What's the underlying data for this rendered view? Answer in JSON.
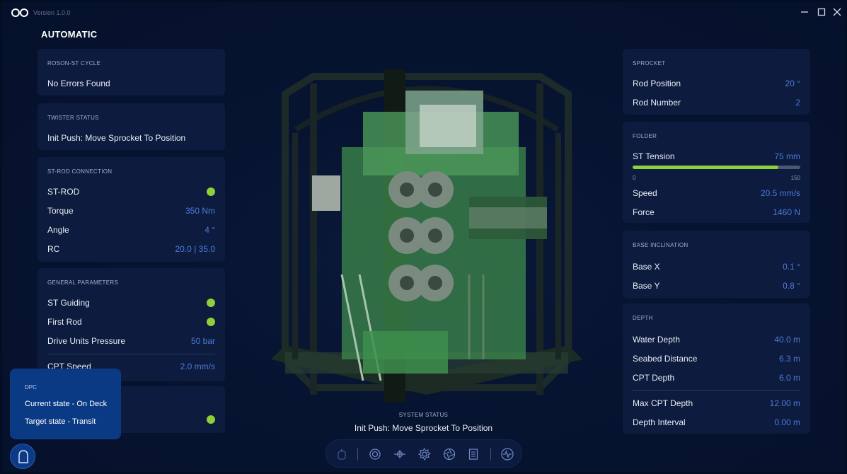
{
  "app": {
    "version": "Version 1.0.0",
    "page_title": "AUTOMATIC"
  },
  "left": {
    "cycle": {
      "title": "ROSON-ST CYCLE",
      "text": "No Errors Found"
    },
    "twister": {
      "title": "TWISTER STATUS",
      "text": "Init Push: Move Sprocket To Position"
    },
    "st_rod": {
      "title": "ST-ROD CONNECTION",
      "rows": [
        {
          "label": "ST-ROD",
          "status": "ok"
        },
        {
          "label": "Torque",
          "value": "350 Nm"
        },
        {
          "label": "Angle",
          "value": "4 °"
        },
        {
          "label": "RC",
          "value": "20.0 | 35.0"
        }
      ]
    },
    "general": {
      "title": "GENERAL PARAMETERS",
      "rows": [
        {
          "label": "ST Guiding",
          "status": "ok"
        },
        {
          "label": "First Rod",
          "status": "ok"
        },
        {
          "label": "Drive Units Pressure",
          "value": "50 bar"
        },
        {
          "label": "CPT Speed",
          "value": "2.0 mm/s"
        }
      ]
    }
  },
  "right": {
    "sprocket": {
      "title": "SPROCKET",
      "rows": [
        {
          "label": "Rod Position",
          "value": "20 °"
        },
        {
          "label": "Rod Number",
          "value": "2"
        }
      ]
    },
    "folder": {
      "title": "FOLDER",
      "tension_label": "ST Tension",
      "tension_value": "75 mm",
      "tension_min": "0",
      "tension_max": "150",
      "tension_fraction": 0.87,
      "rows": [
        {
          "label": "Speed",
          "value": "20.5 mm/s"
        },
        {
          "label": "Force",
          "value": "1460 N"
        }
      ]
    },
    "base": {
      "title": "BASE INCLINATION",
      "rows": [
        {
          "label": "Base X",
          "value": "0.1 °"
        },
        {
          "label": "Base Y",
          "value": "0.8 °"
        }
      ]
    },
    "depth": {
      "title": "DEPTH",
      "rows": [
        {
          "label": "Water Depth",
          "value": "40.0 m"
        },
        {
          "label": "Seabed Distance",
          "value": "6.3 m"
        },
        {
          "label": "CPT Depth",
          "value": "6.0 m"
        },
        {
          "label": "Max CPT Depth",
          "value": "12.00 m"
        },
        {
          "label": "Depth Interval",
          "value": "0.00 m"
        }
      ]
    }
  },
  "system_status": {
    "title": "SYSTEM STATUS",
    "text": "Init Push: Move Sprocket To Position"
  },
  "dpc": {
    "title": "DPC",
    "current": "Current state - On Deck",
    "target": "Target state - Transit"
  },
  "colors": {
    "accent": "#4d7bd8",
    "ok": "#8fcf3a",
    "panel": "#0c1b3e",
    "background": "#05112b"
  },
  "toolbar_icons": [
    "robot-icon",
    "target-icon",
    "crosshair-icon",
    "gear-icon",
    "aperture-icon",
    "document-icon",
    "waveform-icon"
  ]
}
